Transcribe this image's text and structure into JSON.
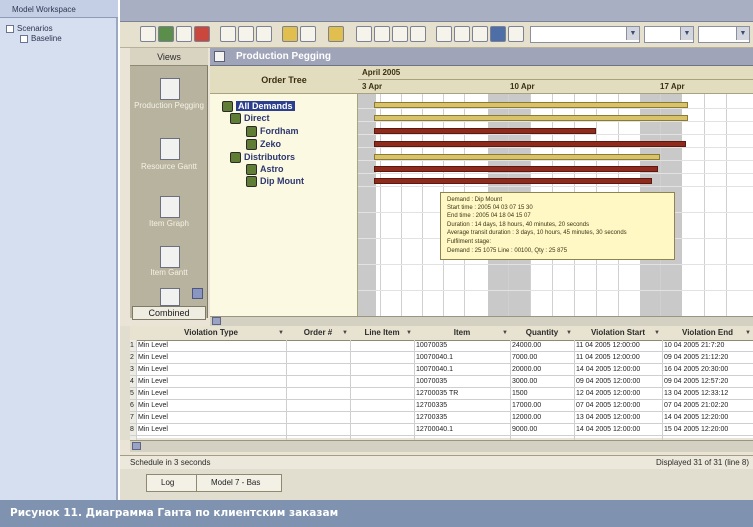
{
  "workspace": {
    "title": "Model Workspace",
    "nodes": [
      {
        "label": "Scenarios"
      },
      {
        "label": "Baseline"
      }
    ]
  },
  "views": {
    "header": "Views",
    "items": [
      {
        "label": "Production Pegging"
      },
      {
        "label": "Resource Gantt"
      },
      {
        "label": "Item Graph"
      },
      {
        "label": "Item Gantt"
      }
    ],
    "combined": "Combined"
  },
  "pegging": {
    "title": "Production Pegging",
    "tree_header": "Order Tree",
    "month": "April 2005",
    "days": [
      "3 Apr",
      "10 Apr",
      "17 Apr"
    ],
    "tree": [
      {
        "label": "All Demands",
        "selected": true
      },
      {
        "label": "Direct"
      },
      {
        "label": "Fordham"
      },
      {
        "label": "Zeko"
      },
      {
        "label": "Distributors"
      },
      {
        "label": "Astro"
      },
      {
        "label": "Dip Mount"
      }
    ],
    "tooltip": [
      "Demand : Dip Mount",
      "Start time : 2005 04 03 07 15 30",
      "End time : 2005 04 18 04 15 07",
      "Duration : 14 days, 18 hours, 40 minutes, 20 seconds",
      "Average transit duration : 3 days, 10 hours, 45 minutes, 30 seconds",
      "Fulfilment stage:",
      "    Demand : 25 1075 Line : 00100, Qty : 25 875"
    ]
  },
  "table": {
    "columns": [
      "Violation Type",
      "Order #",
      "Line Item",
      "Item",
      "Quantity",
      "Violation Start",
      "Violation End"
    ],
    "rows": [
      [
        "1",
        "Min Level",
        "",
        "",
        "10070035",
        "24000.00",
        "11 04 2005 12:00:00",
        "10 04 2005 21:7:20"
      ],
      [
        "2",
        "Min Level",
        "",
        "",
        "10070040.1",
        "7000.00",
        "11 04 2005 12:00:00",
        "09 04 2005 21:12:20"
      ],
      [
        "3",
        "Min Level",
        "",
        "",
        "10070040.1",
        "20000.00",
        "14 04 2005 12:00:00",
        "16 04 2005 20:30:00"
      ],
      [
        "4",
        "Min Level",
        "",
        "",
        "10070035",
        "3000.00",
        "09 04 2005 12:00:00",
        "09 04 2005 12:57:20"
      ],
      [
        "5",
        "Min Level",
        "",
        "",
        "12700035 TR",
        "1500",
        "12 04 2005 12:00:00",
        "13 04 2005 12:33:12"
      ],
      [
        "6",
        "Min Level",
        "",
        "",
        "12700335",
        "17000.00",
        "07 04 2005 12:00:00",
        "07 04 2005 21:02:20"
      ],
      [
        "7",
        "Min Level",
        "",
        "",
        "12700335",
        "12000.00",
        "13 04 2005 12:00:00",
        "14 04 2005 12:20:00"
      ],
      [
        "8",
        "Min Level",
        "",
        "",
        "12700040.1",
        "9000.00",
        "14 04 2005 12:00:00",
        "15 04 2005 12:20:00"
      ]
    ]
  },
  "status": {
    "left": "Schedule in 3 seconds",
    "right": "Displayed 31 of 31 (line 8)"
  },
  "tabs": [
    {
      "label": "Log"
    },
    {
      "label": "Model 7 - Bas"
    }
  ],
  "caption": "Рисунок 11. Диаграмма Ганта по клиентским заказам"
}
